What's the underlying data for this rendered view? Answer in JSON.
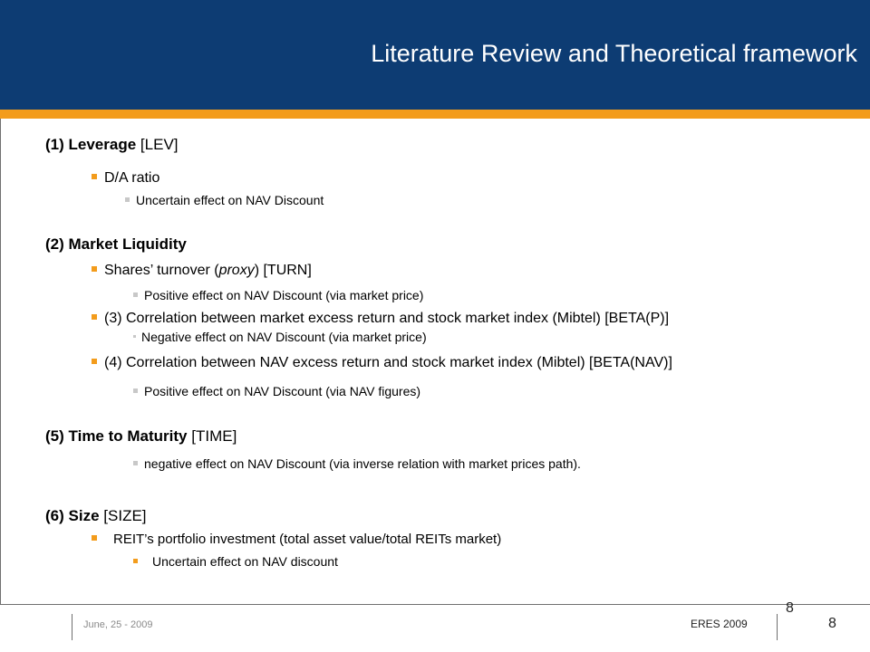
{
  "header": {
    "title": "Literature Review and Theoretical framework"
  },
  "sections": {
    "leverage": {
      "num": "(1)",
      "title": "Leverage",
      "tag": "[LEV]",
      "item": "D/A ratio",
      "sub": "Uncertain effect on NAV Discount"
    },
    "liquidity": {
      "num": "(2)",
      "title": "Market Liquidity",
      "item1_pre": "Shares’ turnover (",
      "item1_em": "proxy",
      "item1_post": ") [TURN]",
      "item1_sub": "Positive effect on NAV Discount (via market price)",
      "item2": "(3) Correlation between market excess return and stock market index (Mibtel) [BETA(P)]",
      "item2_sub": "Negative effect on NAV Discount (via market price)",
      "item3": "(4) Correlation between NAV excess return and stock market index (Mibtel) [BETA(NAV)]",
      "item3_sub": "Positive effect on NAV Discount (via NAV figures)"
    },
    "time": {
      "num": "(5)",
      "title": "Time to Maturity",
      "tag": "[TIME]",
      "sub": "negative effect on NAV Discount (via inverse relation with market prices path)."
    },
    "size": {
      "num": "(6)",
      "title": "Size",
      "tag": "[SIZE]",
      "item": "REIT’s portfolio investment (total asset value/total REITs market)",
      "sub": "Uncertain effect on NAV discount"
    }
  },
  "footer": {
    "date": "June, 25 - 2009",
    "conference": "ERES 2009",
    "page_upper": "8",
    "page_lower": "8"
  },
  "colors": {
    "header_bg": "#0d3c73",
    "accent_orange": "#f39c1c",
    "sub_bullet_grey": "#c8c8c8"
  }
}
